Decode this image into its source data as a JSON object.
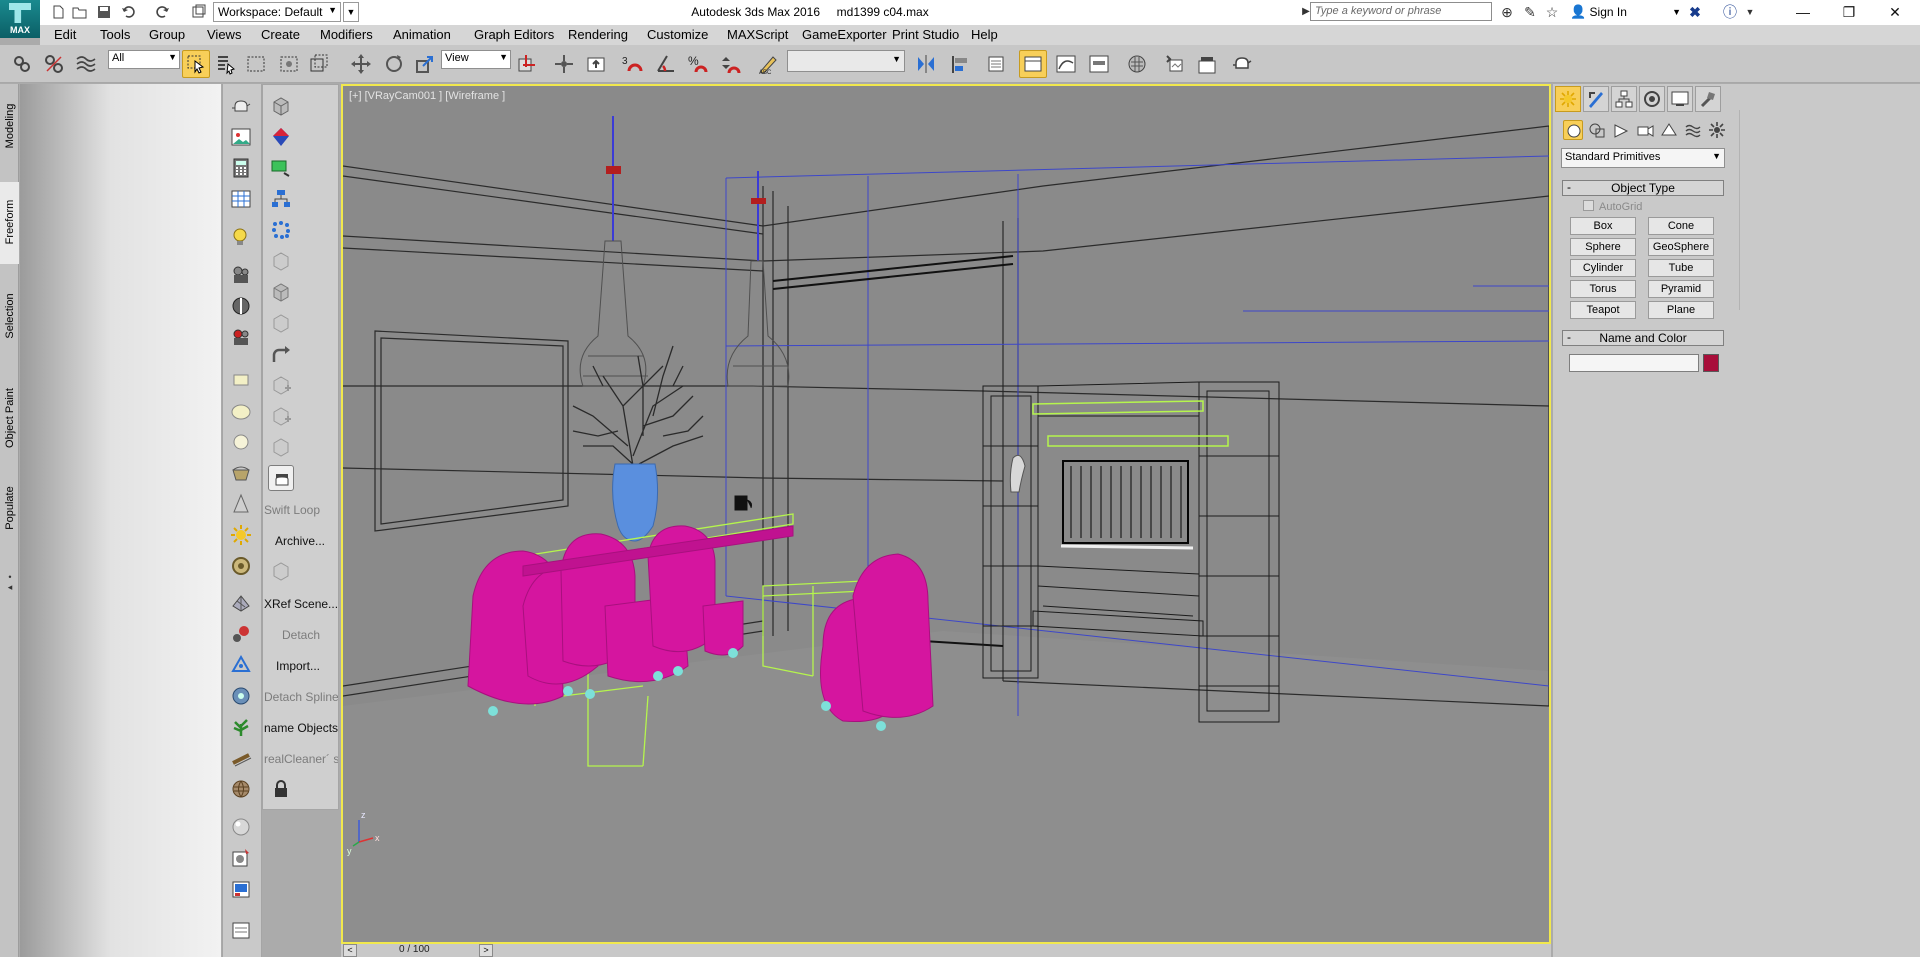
{
  "app": {
    "logo_text": "MAX",
    "window_title": "Autodesk 3ds Max 2016     md1399 c04.max",
    "workspace_label": "Workspace: Default",
    "search_placeholder": "Type a keyword or phrase",
    "sign_in": "Sign In"
  },
  "menu": {
    "items": [
      "Edit",
      "Tools",
      "Group",
      "Views",
      "Create",
      "Modifiers",
      "Animation",
      "Graph Editors",
      "Rendering",
      "Customize",
      "MAXScript",
      "GameExporter",
      "Print Studio",
      "Help"
    ]
  },
  "main_toolbar": {
    "selection_filter": "All",
    "reference_coord": "View",
    "snap_toggle_label": "3",
    "named_selection": ""
  },
  "ribbon": {
    "tabs": [
      "Modeling",
      "Freeform",
      "Selection",
      "Object Paint",
      "Populate"
    ],
    "active_tab": "Freeform"
  },
  "plugin_panel": {
    "buttons": [
      "Swift Loop",
      "Archive...",
      "XRef Scene...",
      "Detach",
      "Import...",
      "Detach Spline",
      "Rename Objects",
      "RealCleaner"
    ],
    "labels_visible": [
      "Swift Loop",
      "Archive...",
      "XRef Scene...",
      "Detach",
      "Import...",
      "Detach Spline",
      "name Objects",
      "realCleaner´ s"
    ]
  },
  "viewport": {
    "label": "[+] [VRayCam001 ] [Wireframe ]",
    "active_border_color": "#f1e84d",
    "axis_labels": {
      "x": "x",
      "y": "y",
      "z": "z"
    }
  },
  "time_slider": {
    "frame_text": "0 / 100"
  },
  "command_panel": {
    "primitive_type": "Standard Primitives",
    "object_type_title": "Object Type",
    "autogrid_label": "AutoGrid",
    "primitives": [
      "Box",
      "Cone",
      "Sphere",
      "GeoSphere",
      "Cylinder",
      "Tube",
      "Torus",
      "Pyramid",
      "Teapot",
      "Plane"
    ],
    "name_color_title": "Name and Color",
    "object_name": "",
    "object_color": "#a80e3a"
  },
  "colors": {
    "active_highlight": "#f8cf59",
    "chairs": "#d5159f",
    "selection_wire": "#b5f54d",
    "vase": "#5a8fde"
  }
}
